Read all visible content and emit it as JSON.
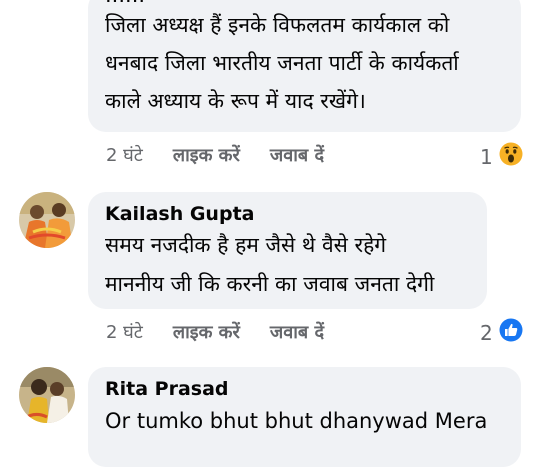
{
  "comment1": {
    "lines": [
      "जिला अध्यक्ष हैं इनके विफलतम कार्यकाल को",
      "धनबाद जिला भारतीय जनता पार्टी के कार्यकर्ता",
      "काले अध्याय के रूप में याद रखेंगे।"
    ],
    "time": "2 घंटे",
    "like": "लाइक करें",
    "reply": "जवाब दें",
    "reaction_count": "1",
    "reaction_icon": "wow-icon"
  },
  "comment2": {
    "author": "Kailash Gupta",
    "lines": [
      "समय नजदीक है हम जैसे थे वैसे रहेगे",
      "माननीय जी कि करनी का जवाब जनता देगी"
    ],
    "time": "2 घंटे",
    "like": "लाइक करें",
    "reply": "जवाब दें",
    "reaction_count": "2",
    "reaction_icon": "like-icon"
  },
  "comment3": {
    "author": "Rita Prasad",
    "lines": [
      "Or tumko bhut bhut dhanywad Mera"
    ]
  },
  "colors": {
    "bubble": "#f0f2f5",
    "meta": "#65676b",
    "like_blue": "#1877f2",
    "wow_yellow": "#f7b125"
  }
}
